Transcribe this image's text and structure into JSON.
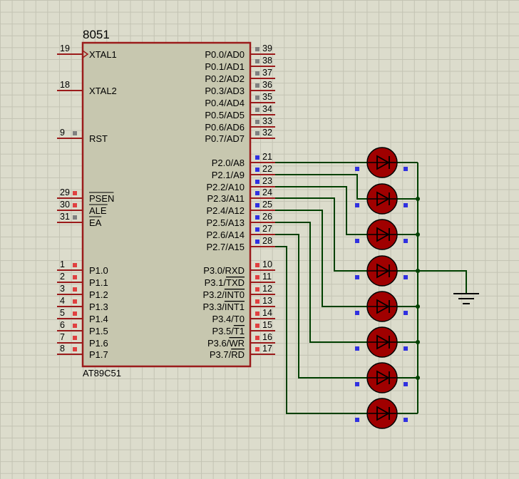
{
  "chip": {
    "title": "8051",
    "part": "AT89C51"
  },
  "pins_left": [
    {
      "num": "19",
      "label": "XTAL1",
      "clock": true
    },
    {
      "num": "18",
      "label": "XTAL2"
    },
    {
      "num": "9",
      "label": "RST",
      "marker": "gray"
    },
    {
      "num": "29",
      "label": "PSEN",
      "overline": true,
      "marker": "red"
    },
    {
      "num": "30",
      "label": "ALE",
      "overline": true,
      "marker": "red"
    },
    {
      "num": "31",
      "label": "EA",
      "overline": true,
      "marker": "gray"
    },
    {
      "num": "1",
      "label": "P1.0",
      "marker": "red"
    },
    {
      "num": "2",
      "label": "P1.1",
      "marker": "red"
    },
    {
      "num": "3",
      "label": "P1.2",
      "marker": "red"
    },
    {
      "num": "4",
      "label": "P1.3",
      "marker": "red"
    },
    {
      "num": "5",
      "label": "P1.4",
      "marker": "red"
    },
    {
      "num": "6",
      "label": "P1.5",
      "marker": "red"
    },
    {
      "num": "7",
      "label": "P1.6",
      "marker": "red"
    },
    {
      "num": "8",
      "label": "P1.7",
      "marker": "red"
    }
  ],
  "pins_right": [
    {
      "num": "39",
      "label": "P0.0/AD0",
      "marker": "gray"
    },
    {
      "num": "38",
      "label": "P0.1/AD1",
      "marker": "gray"
    },
    {
      "num": "37",
      "label": "P0.2/AD2",
      "marker": "gray"
    },
    {
      "num": "36",
      "label": "P0.3/AD3",
      "marker": "gray"
    },
    {
      "num": "35",
      "label": "P0.4/AD4",
      "marker": "gray"
    },
    {
      "num": "34",
      "label": "P0.5/AD5",
      "marker": "gray"
    },
    {
      "num": "33",
      "label": "P0.6/AD6",
      "marker": "gray"
    },
    {
      "num": "32",
      "label": "P0.7/AD7",
      "marker": "gray"
    },
    {
      "num": "21",
      "label": "P2.0/A8",
      "marker": "blue"
    },
    {
      "num": "22",
      "label": "P2.1/A9",
      "marker": "blue"
    },
    {
      "num": "23",
      "label": "P2.2/A10",
      "marker": "blue"
    },
    {
      "num": "24",
      "label": "P2.3/A11",
      "marker": "blue"
    },
    {
      "num": "25",
      "label": "P2.4/A12",
      "marker": "blue"
    },
    {
      "num": "26",
      "label": "P2.5/A13",
      "marker": "blue"
    },
    {
      "num": "27",
      "label": "P2.6/A14",
      "marker": "blue"
    },
    {
      "num": "28",
      "label": "P2.7/A15",
      "marker": "blue"
    },
    {
      "num": "10",
      "label": "P3.0/RXD",
      "marker": "red"
    },
    {
      "num": "11",
      "label": "P3.1/",
      "ol": "TXD",
      "marker": "red"
    },
    {
      "num": "12",
      "label": "P3.2/",
      "ol": "INT0",
      "marker": "red"
    },
    {
      "num": "13",
      "label": "P3.3/",
      "ol": "INT1",
      "marker": "red"
    },
    {
      "num": "14",
      "label": "P3.4/T0",
      "marker": "red"
    },
    {
      "num": "15",
      "label": "P3.5/",
      "ol": "T1",
      "marker": "red"
    },
    {
      "num": "16",
      "label": "P3.6/",
      "ol": "WR",
      "marker": "red"
    },
    {
      "num": "17",
      "label": "P3.7/",
      "ol": "RD",
      "marker": "red"
    }
  ],
  "leds": {
    "count": 8,
    "color": "#a00000",
    "outline": "#000000"
  },
  "colors": {
    "chip_fill": "#c7c7af",
    "chip_border": "#9b1b1b",
    "pin_line": "#9b1b1b",
    "wire": "#004000",
    "pin_red": "#e04040",
    "pin_gray": "#808080",
    "pin_blue": "#3030e0"
  }
}
